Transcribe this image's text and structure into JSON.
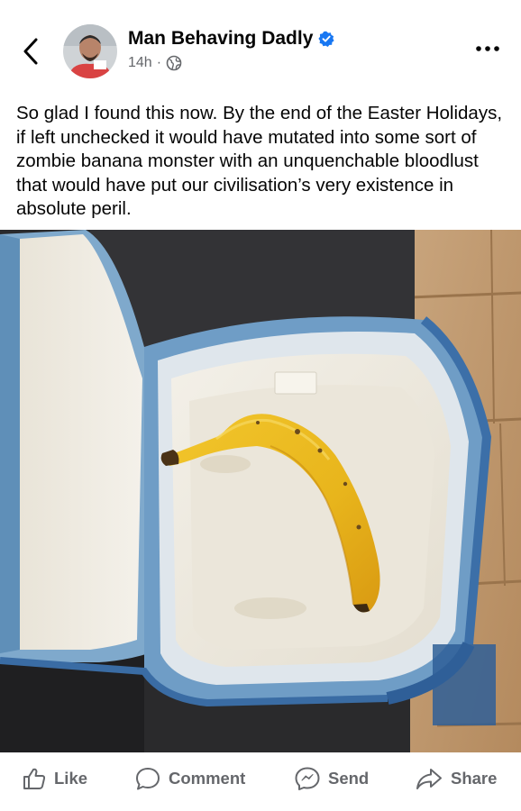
{
  "post": {
    "author": "Man Behaving Dadly",
    "time": "14h",
    "separator": "·",
    "text": "So glad I found this now. By the end of the Easter Holidays, if left unchecked it would have mutated into some sort of zombie banana monster with an unquenchable bloodlust that would have put our civilisation’s very existence in absolute peril."
  },
  "actions": {
    "like": "Like",
    "comment": "Comment",
    "send": "Send",
    "share": "Share"
  },
  "icons": {
    "back": "chevron-left-icon",
    "verified": "verified-badge-icon",
    "audience": "globe-icon",
    "more": "more-dots-icon",
    "like": "thumbs-up-icon",
    "comment": "comment-bubble-icon",
    "send": "messenger-icon",
    "share": "share-arrow-icon"
  },
  "colors": {
    "verified": "#1877f2",
    "secondary_text": "#65676b"
  }
}
